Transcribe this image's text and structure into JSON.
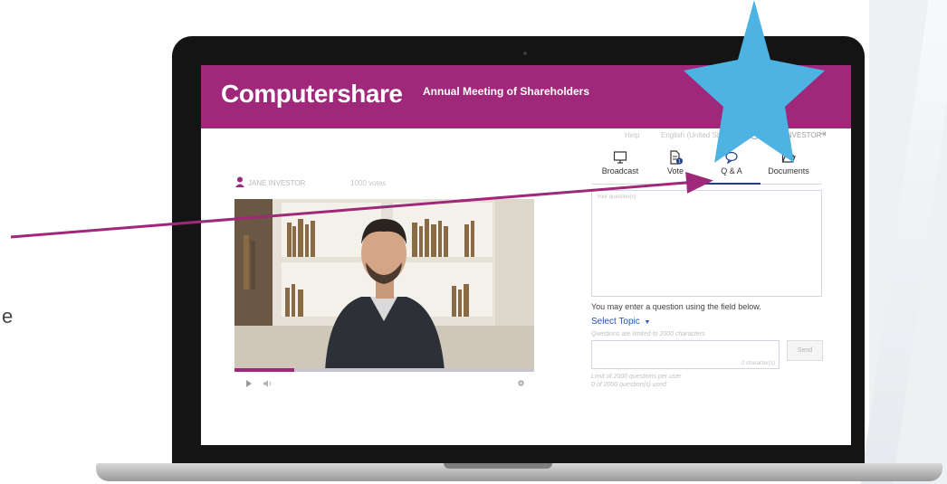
{
  "side_text": "e",
  "header": {
    "brand": "Computershare",
    "title": "Annual Meeting of Shareholders"
  },
  "utility_bar": {
    "help": "Help",
    "language": "English (United States)",
    "user": "JANE INVESTOR"
  },
  "tabs": [
    {
      "label": "Broadcast",
      "icon": "monitor-icon"
    },
    {
      "label": "Vote",
      "icon": "document-icon",
      "badge": "1"
    },
    {
      "label": "Q & A",
      "icon": "chat-bubble-icon",
      "active": true
    },
    {
      "label": "Documents",
      "icon": "folder-icon"
    }
  ],
  "presenter": {
    "name": "JANE INVESTOR",
    "votes": "1000 votes"
  },
  "video": {
    "progress_fraction": 0.2
  },
  "qa": {
    "list_label": "Your question(s)",
    "instructions": "You may enter a question using the field below.",
    "select_topic": "Select Topic",
    "chars_limit": "Questions are limited to 2000  characters",
    "input_placeholder": "",
    "char_counter": "0 character(s)",
    "send_label": "Send",
    "limit_note": "Limit of 2000 questions per user",
    "used_note": "0 of 2000  question(s) used"
  },
  "colors": {
    "brand": "#a0287a",
    "accent_blue": "#2a55b5",
    "star": "#4cb3e3",
    "arrow": "#a0287a"
  }
}
